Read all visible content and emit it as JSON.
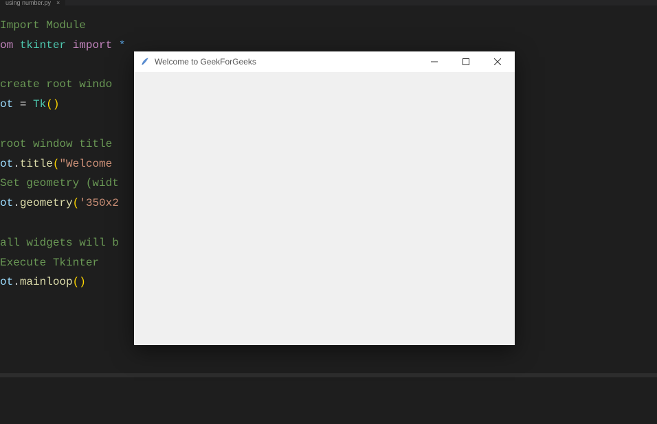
{
  "tab": {
    "filename": "using number.py",
    "close_glyph": "×"
  },
  "code": {
    "line1_comment": "Import Module",
    "line2_from": "om ",
    "line2_module": "tkinter",
    "line2_import": " import ",
    "line2_star": "*",
    "line4_comment": "create root windo",
    "line5_var": "ot ",
    "line5_eq": "= ",
    "line5_class": "Tk",
    "line5_paren": "()",
    "line7_comment": "root window title ",
    "line8_var": "ot",
    "line8_dot": ".",
    "line8_method": "title",
    "line8_open": "(",
    "line8_string": "\"Welcome ",
    "line9_comment": "Set geometry (widt",
    "line10_var": "ot",
    "line10_dot": ".",
    "line10_method": "geometry",
    "line10_open": "(",
    "line10_string": "'350x2",
    "line12_comment": "all widgets will b",
    "line13_comment": "Execute Tkinter",
    "line14_var": "ot",
    "line14_dot": ".",
    "line14_method": "mainloop",
    "line14_paren": "()"
  },
  "tkwindow": {
    "title": "Welcome to GeekForGeeks"
  }
}
